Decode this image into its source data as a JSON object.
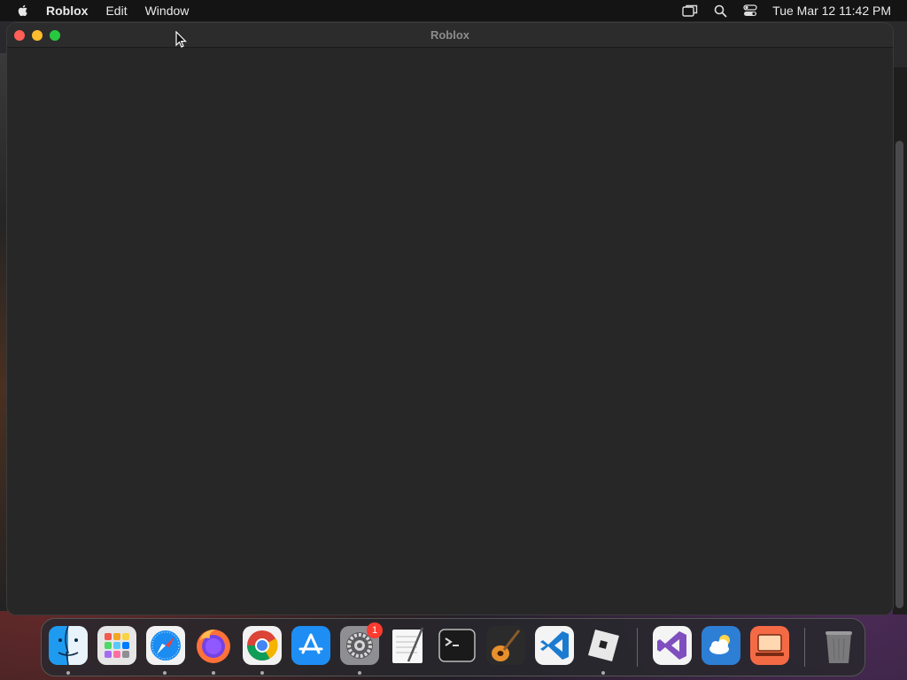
{
  "menubar": {
    "apple_icon": "apple-icon",
    "app_name": "Roblox",
    "items": [
      "Edit",
      "Window"
    ],
    "status_icons": [
      "screen-mirroring-icon",
      "spotlight-search-icon",
      "control-center-icon"
    ],
    "clock": "Tue Mar 12  11:42 PM"
  },
  "window": {
    "title": "Roblox",
    "controls": [
      "close",
      "minimize",
      "maximize"
    ]
  },
  "dock": {
    "apps": [
      {
        "name": "Finder",
        "icon": "finder-icon",
        "running": true
      },
      {
        "name": "Launchpad",
        "icon": "launchpad-icon",
        "running": false
      },
      {
        "name": "Safari",
        "icon": "safari-icon",
        "running": true
      },
      {
        "name": "Firefox",
        "icon": "firefox-icon",
        "running": true
      },
      {
        "name": "Google Chrome",
        "icon": "chrome-icon",
        "running": true
      },
      {
        "name": "App Store",
        "icon": "app-store-icon",
        "running": false
      },
      {
        "name": "System Settings",
        "icon": "system-settings-icon",
        "running": true,
        "badge": "1"
      },
      {
        "name": "TextEdit",
        "icon": "textedit-icon",
        "running": false
      },
      {
        "name": "Terminal",
        "icon": "terminal-icon",
        "running": false
      },
      {
        "name": "GarageBand",
        "icon": "garageband-icon",
        "running": false
      },
      {
        "name": "Visual Studio Code",
        "icon": "vscode-icon",
        "running": false
      },
      {
        "name": "Roblox",
        "icon": "roblox-icon",
        "running": true
      },
      {
        "name": "Visual Studio",
        "icon": "visual-studio-icon",
        "running": false
      },
      {
        "name": "Weather",
        "icon": "weather-icon",
        "running": false
      },
      {
        "name": "Screen Sharing",
        "icon": "screen-sharing-icon",
        "running": false
      },
      {
        "name": "Trash",
        "icon": "trash-icon",
        "running": false
      }
    ]
  }
}
